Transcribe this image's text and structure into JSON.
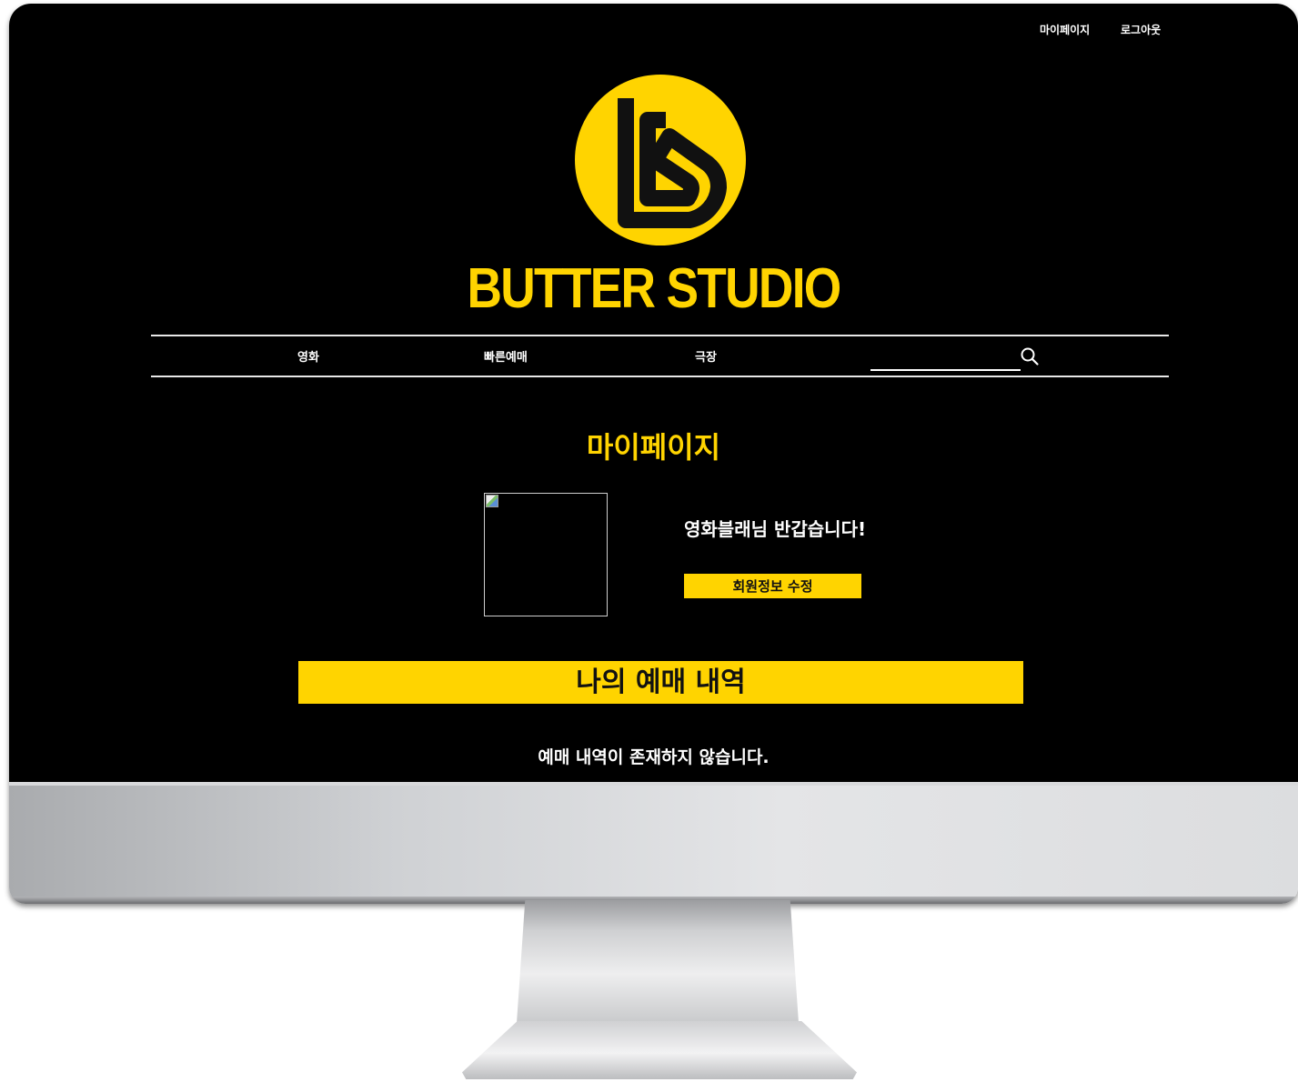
{
  "header": {
    "links": {
      "mypage": "마이페이지",
      "logout": "로그아웃"
    },
    "brand": "BUTTER STUDIO",
    "logo_icon": "butter-studio-b-logo"
  },
  "nav": {
    "items": [
      "영화",
      "빠른예매",
      "극장"
    ],
    "search": {
      "value": "",
      "icon": "search-icon"
    }
  },
  "main": {
    "title": "마이페이지",
    "profile": {
      "image": "broken-image",
      "greeting": "영화블래님 반갑습니다!",
      "edit_button": "회원정보 수정"
    },
    "reservations": {
      "heading": "나의 예매 내역",
      "empty_message": "예매 내역이 존재하지 않습니다."
    }
  },
  "colors": {
    "accent": "#ffd400",
    "background": "#000000",
    "text": "#ffffff"
  }
}
